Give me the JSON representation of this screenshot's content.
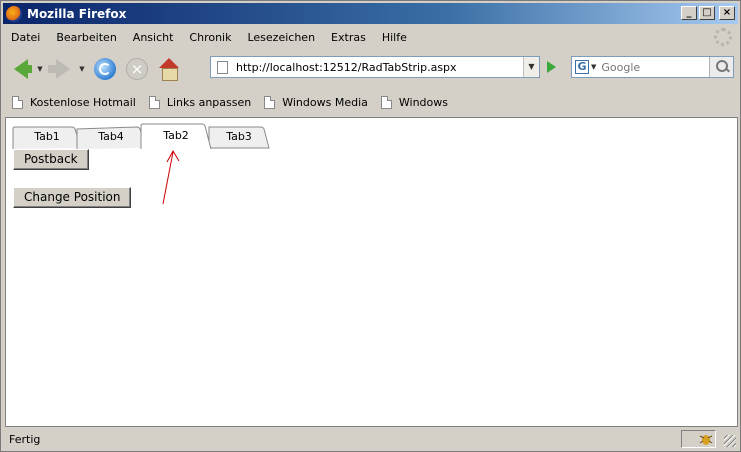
{
  "window": {
    "title": "Mozilla Firefox",
    "buttons": {
      "minimize": "_",
      "maximize": "□",
      "close": "×"
    }
  },
  "menu": [
    "Datei",
    "Bearbeiten",
    "Ansicht",
    "Chronik",
    "Lesezeichen",
    "Extras",
    "Hilfe"
  ],
  "navigation": {
    "url": "http://localhost:12512/RadTabStrip.aspx",
    "search_placeholder": "Google",
    "search_engine_icon": "G"
  },
  "bookmarks": [
    "Kostenlose Hotmail",
    "Links anpassen",
    "Windows Media",
    "Windows"
  ],
  "page": {
    "tabs": [
      {
        "label": "Tab1",
        "selected": false
      },
      {
        "label": "Tab4",
        "selected": false
      },
      {
        "label": "Tab2",
        "selected": true
      },
      {
        "label": "Tab3",
        "selected": false
      }
    ],
    "postback_label": "Postback",
    "change_position_label": "Change Position",
    "annotation_color": "#cc0000"
  },
  "status": {
    "text": "Fertig"
  }
}
